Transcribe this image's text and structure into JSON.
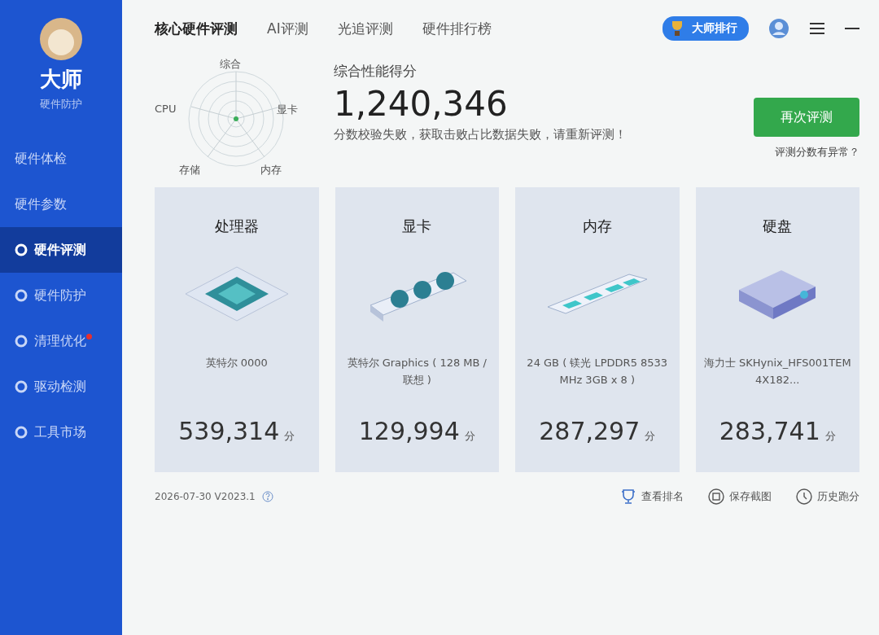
{
  "sidebar": {
    "brand": "大师",
    "subtitle": "硬件防护",
    "items": [
      {
        "label": "硬件体检",
        "selected": false,
        "badge": false
      },
      {
        "label": "硬件参数",
        "selected": false,
        "badge": false
      },
      {
        "label": "硬件评测",
        "selected": true,
        "badge": false
      },
      {
        "label": "硬件防护",
        "selected": false,
        "badge": false
      },
      {
        "label": "清理优化",
        "selected": false,
        "badge": true
      },
      {
        "label": "驱动检测",
        "selected": false,
        "badge": false
      },
      {
        "label": "工具市场",
        "selected": false,
        "badge": false
      }
    ]
  },
  "tabs": [
    {
      "label": "核心硬件评测",
      "selected": true
    },
    {
      "label": "AI评测",
      "selected": false
    },
    {
      "label": "光追评测",
      "selected": false
    },
    {
      "label": "硬件排行榜",
      "selected": false
    }
  ],
  "top_actions": {
    "ranking_button": "大师排行"
  },
  "radar": {
    "labels": [
      {
        "text": "综合",
        "kind": "top"
      },
      {
        "text": "显卡",
        "kind": "right"
      },
      {
        "text": "内存",
        "kind": "bottom-right"
      },
      {
        "text": "存储",
        "kind": "bottom-left"
      },
      {
        "text": "CPU",
        "kind": "left"
      }
    ]
  },
  "summary": {
    "title": "综合性能得分",
    "score": "1,240,346",
    "message": "分数校验失败，获取击败占比数据失败，请重新评测！",
    "retest_button": "再次评测",
    "anomaly_link": "评测分数有异常？"
  },
  "cards": [
    {
      "kind": "cpu",
      "title": "处理器",
      "device": "英特尔 0000",
      "score": "539,314",
      "unit": "分"
    },
    {
      "kind": "gpu",
      "title": "显卡",
      "device": "英特尔 Graphics ( 128 MB / 联想 )",
      "score": "129,994",
      "unit": "分"
    },
    {
      "kind": "memory",
      "title": "内存",
      "device": "24 GB ( 镁光 LPDDR5 8533MHz 3GB x 8 )",
      "score": "287,297",
      "unit": "分"
    },
    {
      "kind": "disk",
      "title": "硬盘",
      "device": "海力士 SKHynix_HFS001TEM4X182...",
      "score": "283,741",
      "unit": "分"
    }
  ],
  "footer": {
    "version": "2026-07-30 V2023.1",
    "actions": [
      {
        "kind": "rank",
        "label": "查看排名"
      },
      {
        "kind": "save",
        "label": "保存截图"
      },
      {
        "kind": "history",
        "label": "历史跑分"
      }
    ]
  }
}
